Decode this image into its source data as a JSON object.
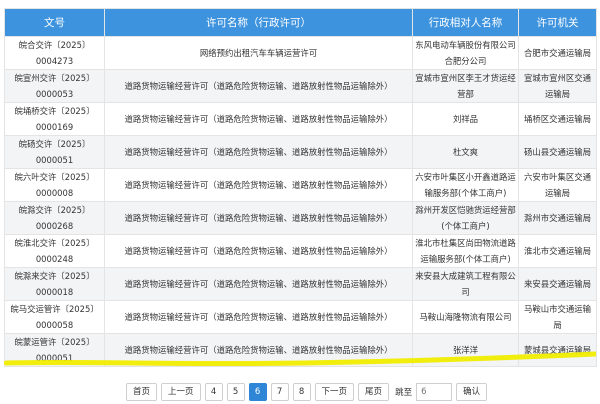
{
  "table": {
    "headers": [
      "文号",
      "许可名称（行政许可）",
      "行政相对人名称",
      "许可机关"
    ],
    "rows": [
      [
        "皖合交许〔2025〕0004273",
        "网络预约出租汽车车辆运营许可",
        "东风电动车辆股份有限公司合肥分公司",
        "合肥市交通运输局"
      ],
      [
        "皖宣州交许〔2025〕0000053",
        "道路货物运输经营许可（道路危险货物运输、道路放射性物品运输除外）",
        "宣城市宣州区李王才货运经营部",
        "宣城市宣州区交通运输局"
      ],
      [
        "皖埇桥交许〔2025〕0000169",
        "道路货物运输经营许可（道路危险货物运输、道路放射性物品运输除外）",
        "刘祥品",
        "埇桥区交通运输局"
      ],
      [
        "皖砀交许〔2025〕0000051",
        "道路货物运输经营许可（道路危险货物运输、道路放射性物品运输除外）",
        "杜文爽",
        "砀山县交通运输局"
      ],
      [
        "皖六叶交许〔2025〕0000008",
        "道路货物运输经营许可（道路危险货物运输、道路放射性物品运输除外）",
        "六安市叶集区小开鑫道路运输服务部(个体工商户)",
        "六安市叶集区交通运输局"
      ],
      [
        "皖滁交许〔2025〕0000268",
        "道路货物运输经营许可（道路危险货物运输、道路放射性物品运输除外）",
        "滁州开发区恺驰货运经营部(个体工商户)",
        "滁州市交通运输局"
      ],
      [
        "皖淮北交许〔2025〕0000248",
        "道路货物运输经营许可（道路危险货物运输、道路放射性物品运输除外）",
        "淮北市杜集区尚田物流道路运输服务部(个体工商户)",
        "淮北市交通运输局"
      ],
      [
        "皖滁来交许〔2025〕0000018",
        "道路货物运输经营许可（道路危险货物运输、道路放射性物品运输除外）",
        "来安县大成建筑工程有限公司",
        "来安县交通运输局"
      ],
      [
        "皖马交运管许〔2025〕0000058",
        "道路货物运输经营许可（道路危险货物运输、道路放射性物品运输除外）",
        "马鞍山海隆物流有限公司",
        "马鞍山市交通运输局"
      ],
      [
        "皖蒙运管许〔2025〕0000051",
        "道路货物运输经营许可（道路危险货物运输、道路放射性物品运输除外）",
        "张洋洋",
        "蒙城县交通运输局"
      ]
    ]
  },
  "pagination": {
    "first": "首页",
    "prev": "上一页",
    "pages": [
      "4",
      "5",
      "6",
      "7",
      "8"
    ],
    "current": "6",
    "next": "下一页",
    "last": "尾页",
    "jump_label": "跳至",
    "jump_placeholder": "6",
    "confirm": "确认"
  },
  "colors": {
    "header_bg": "#3d93de",
    "active_page": "#2f86d6",
    "highlight": "#f0ec00"
  }
}
